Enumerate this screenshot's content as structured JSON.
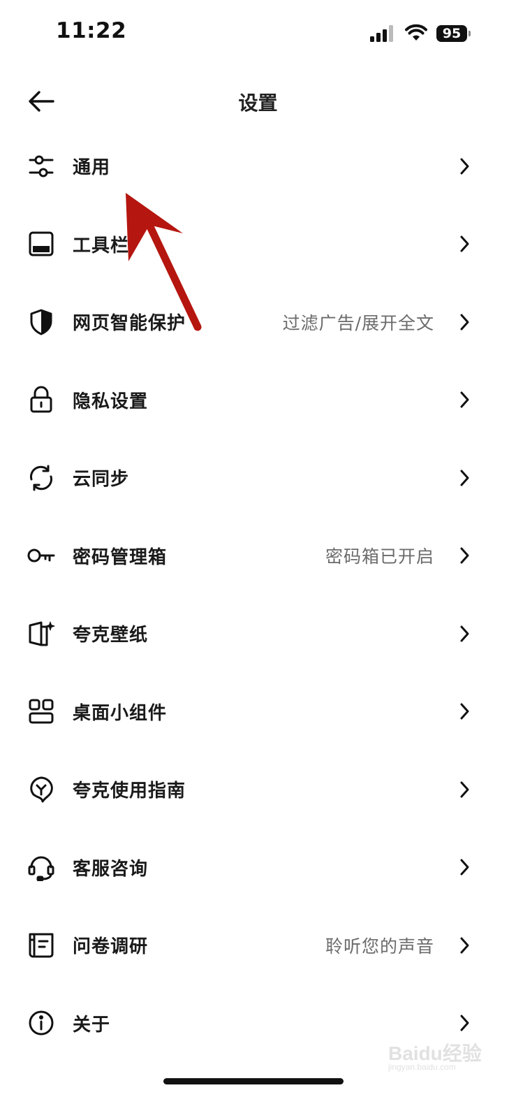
{
  "status_bar": {
    "time": "11:22",
    "battery": "95"
  },
  "header": {
    "title": "设置"
  },
  "menu": [
    {
      "label": "通用",
      "value": "",
      "icon": "sliders-icon"
    },
    {
      "label": "工具栏",
      "value": "",
      "icon": "toolbar-icon"
    },
    {
      "label": "网页智能保护",
      "value": "过滤广告/展开全文",
      "icon": "shield-icon"
    },
    {
      "label": "隐私设置",
      "value": "",
      "icon": "lock-icon"
    },
    {
      "label": "云同步",
      "value": "",
      "icon": "sync-icon"
    },
    {
      "label": "密码管理箱",
      "value": "密码箱已开启",
      "icon": "key-icon"
    },
    {
      "label": "夸克壁纸",
      "value": "",
      "icon": "wallpaper-icon"
    },
    {
      "label": "桌面小组件",
      "value": "",
      "icon": "widgets-icon"
    },
    {
      "label": "夸克使用指南",
      "value": "",
      "icon": "guide-icon"
    },
    {
      "label": "客服咨询",
      "value": "",
      "icon": "headset-icon"
    },
    {
      "label": "问卷调研",
      "value": "聆听您的声音",
      "icon": "survey-icon"
    },
    {
      "label": "关于",
      "value": "",
      "icon": "info-icon"
    }
  ],
  "watermark": {
    "text": "Baidu经验",
    "sub": "jingyan.baidu.com"
  },
  "colors": {
    "annotation_arrow": "#b5160f",
    "value_text": "#6b6b6b"
  }
}
